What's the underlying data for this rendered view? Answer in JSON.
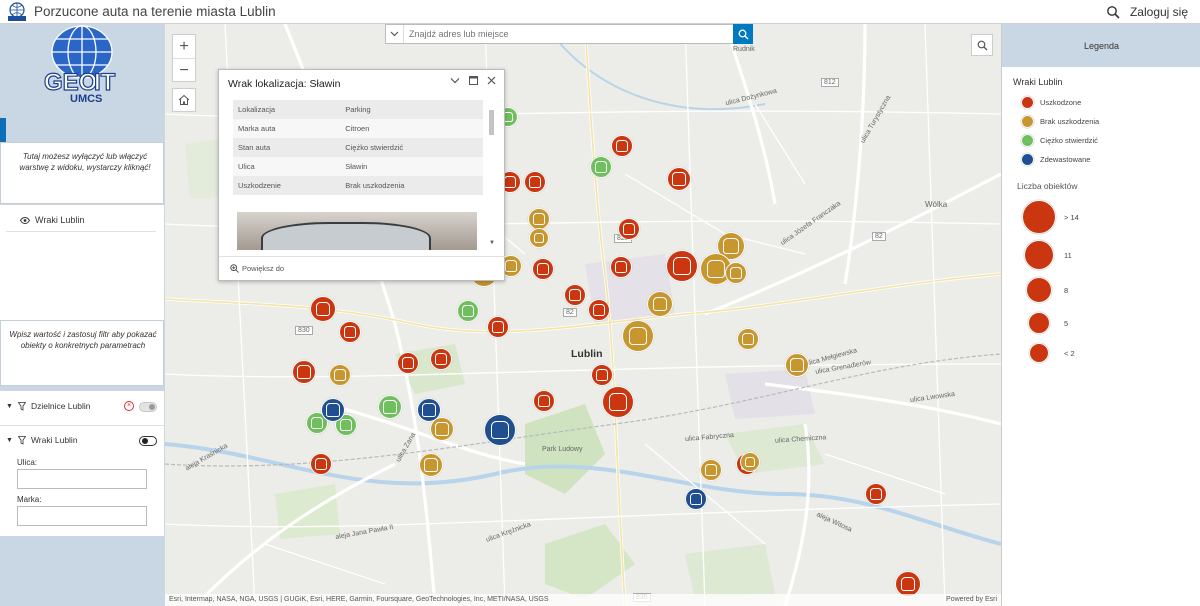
{
  "app": {
    "title": "Porzucone auta na terenie miasta Lublin",
    "login_label": "Zaloguj się",
    "logo_top_alt": "GEOIT",
    "logo_text_geo": "GEO",
    "logo_text_it": "IT",
    "logo_text_umcs": "UMCS"
  },
  "sidebar": {
    "hint_layers": "Tutaj możesz wyłączyć lub włączyć warstwę z widoku, wystarczy kliknąć!",
    "layer_name": "Wraki Lublin",
    "hint_filter": "Wpisz wartość i zastosuj filtr aby pokazać obiekty o konkretnych parametrach",
    "filters": [
      {
        "label": "Dzielnice Lublin"
      },
      {
        "label": "Wraki Lublin"
      }
    ],
    "field_ulica_label": "Ulica:",
    "field_marka_label": "Marka:"
  },
  "search": {
    "placeholder": "Znajdź adres lub miejsce"
  },
  "map": {
    "labels": {
      "city": "Lublin",
      "rudnik": "Rudnik",
      "wolka": "Wólka",
      "park": "Park Ludowy",
      "r830": "830",
      "r812": "812",
      "r82": "82",
      "r822": "822",
      "r82b": "82",
      "r835": "835",
      "s1": "ulica Dożynkowa",
      "s2": "ulica Zana",
      "s3": "ulica Lwowska",
      "s4": "ulica Józefa Franczaka",
      "s5": "ulica Grenadierów",
      "s6": "ulica Fabryczna",
      "s7": "aleja Kraśnicka",
      "s8": "aleja Jana Pawła II",
      "s9": "aleja Witosa",
      "s10": "ulica Krężnicka",
      "s11": "ulica Mełgiewska",
      "s12": "ulica Turystyczna",
      "s13": "ulica Chemiczna"
    },
    "attribution": "Esri, Intermap, NASA, NGA, USGS | GUGiK, Esri, HERE, Garmin, Foursquare, GeoTechnologies, Inc, METI/NASA, USGS",
    "powered_by": "Powered by Esri",
    "category_colors": {
      "uszkodzone": "#c9360f",
      "brak_uszkodzenia": "#c8962f",
      "ciezko_stwierdzic": "#6fbf5e",
      "zdewastowane": "#1f4e91"
    }
  },
  "popup": {
    "title": "Wrak lokalizacja: Sławin",
    "rows": [
      {
        "k": "Lokalizacja",
        "v": "Parking"
      },
      {
        "k": "Marka auta",
        "v": "Citroen"
      },
      {
        "k": "Stan auta",
        "v": "Ciężko stwierdzić"
      },
      {
        "k": "Ulica",
        "v": "Sławin"
      },
      {
        "k": "Uszkodzenie",
        "v": "Brak uszkodzenia"
      }
    ],
    "zoom_label": "Powiększ do"
  },
  "legend": {
    "header": "Legenda",
    "layer_title": "Wraki Lublin",
    "items": [
      {
        "label": "Uszkodzone",
        "color": "#c9360f"
      },
      {
        "label": "Brak uszkodzenia",
        "color": "#c8962f"
      },
      {
        "label": "Ciężko stwierdzić",
        "color": "#6fbf5e"
      },
      {
        "label": "Zdewastowane",
        "color": "#1f4e91"
      }
    ],
    "count_title": "Liczba obiektów",
    "sizes": [
      {
        "label": "> 14"
      },
      {
        "label": "11"
      },
      {
        "label": "8"
      },
      {
        "label": "5"
      },
      {
        "label": "< 2"
      }
    ]
  }
}
